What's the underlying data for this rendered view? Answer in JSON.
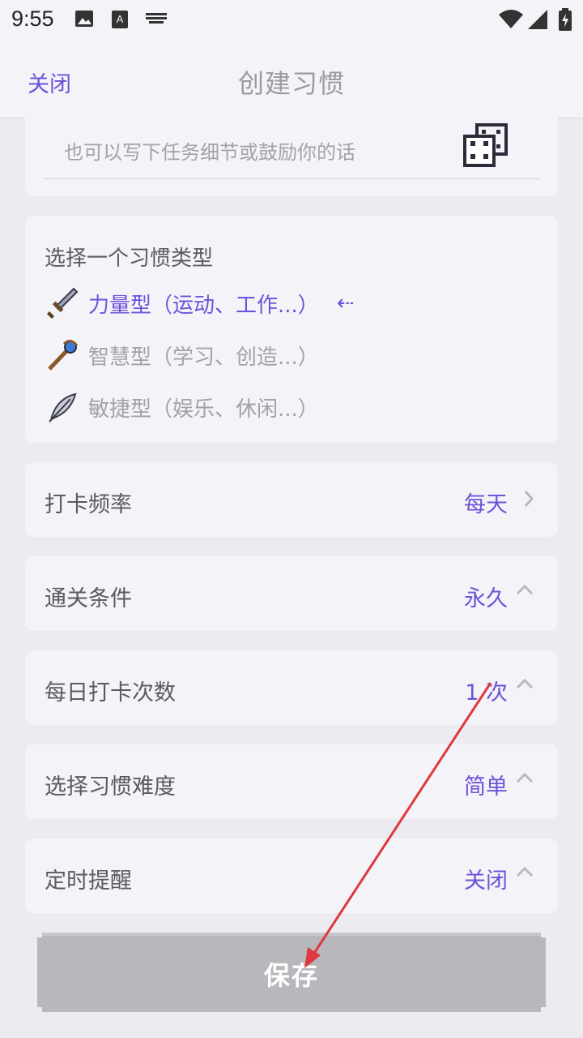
{
  "status_bar": {
    "time": "9:55"
  },
  "header": {
    "close_label": "关闭",
    "title": "创建习惯"
  },
  "note": {
    "placeholder": "也可以写下任务细节或鼓励你的话"
  },
  "habit_type": {
    "title": "选择一个习惯类型",
    "options": [
      {
        "label": "力量型（运动、工作...）",
        "icon": "sword-icon",
        "selected": true
      },
      {
        "label": "智慧型（学习、创造...）",
        "icon": "staff-icon",
        "selected": false
      },
      {
        "label": "敏捷型（娱乐、休闲...）",
        "icon": "feather-icon",
        "selected": false
      }
    ]
  },
  "settings": [
    {
      "label": "打卡频率",
      "value": "每天",
      "chevron": "chevron-right-icon"
    },
    {
      "label": "通关条件",
      "value": "永久",
      "chevron": "chevron-up-icon"
    },
    {
      "label": "每日打卡次数",
      "value": "1 次",
      "chevron": "chevron-up-icon"
    },
    {
      "label": "选择习惯难度",
      "value": "简单",
      "chevron": "chevron-up-icon"
    },
    {
      "label": "定时提醒",
      "value": "关闭",
      "chevron": "chevron-up-icon"
    }
  ],
  "save_label": "保存",
  "colors": {
    "accent": "#6E52D9",
    "annotation": "#E0383E",
    "button": "#B8B7BC"
  }
}
